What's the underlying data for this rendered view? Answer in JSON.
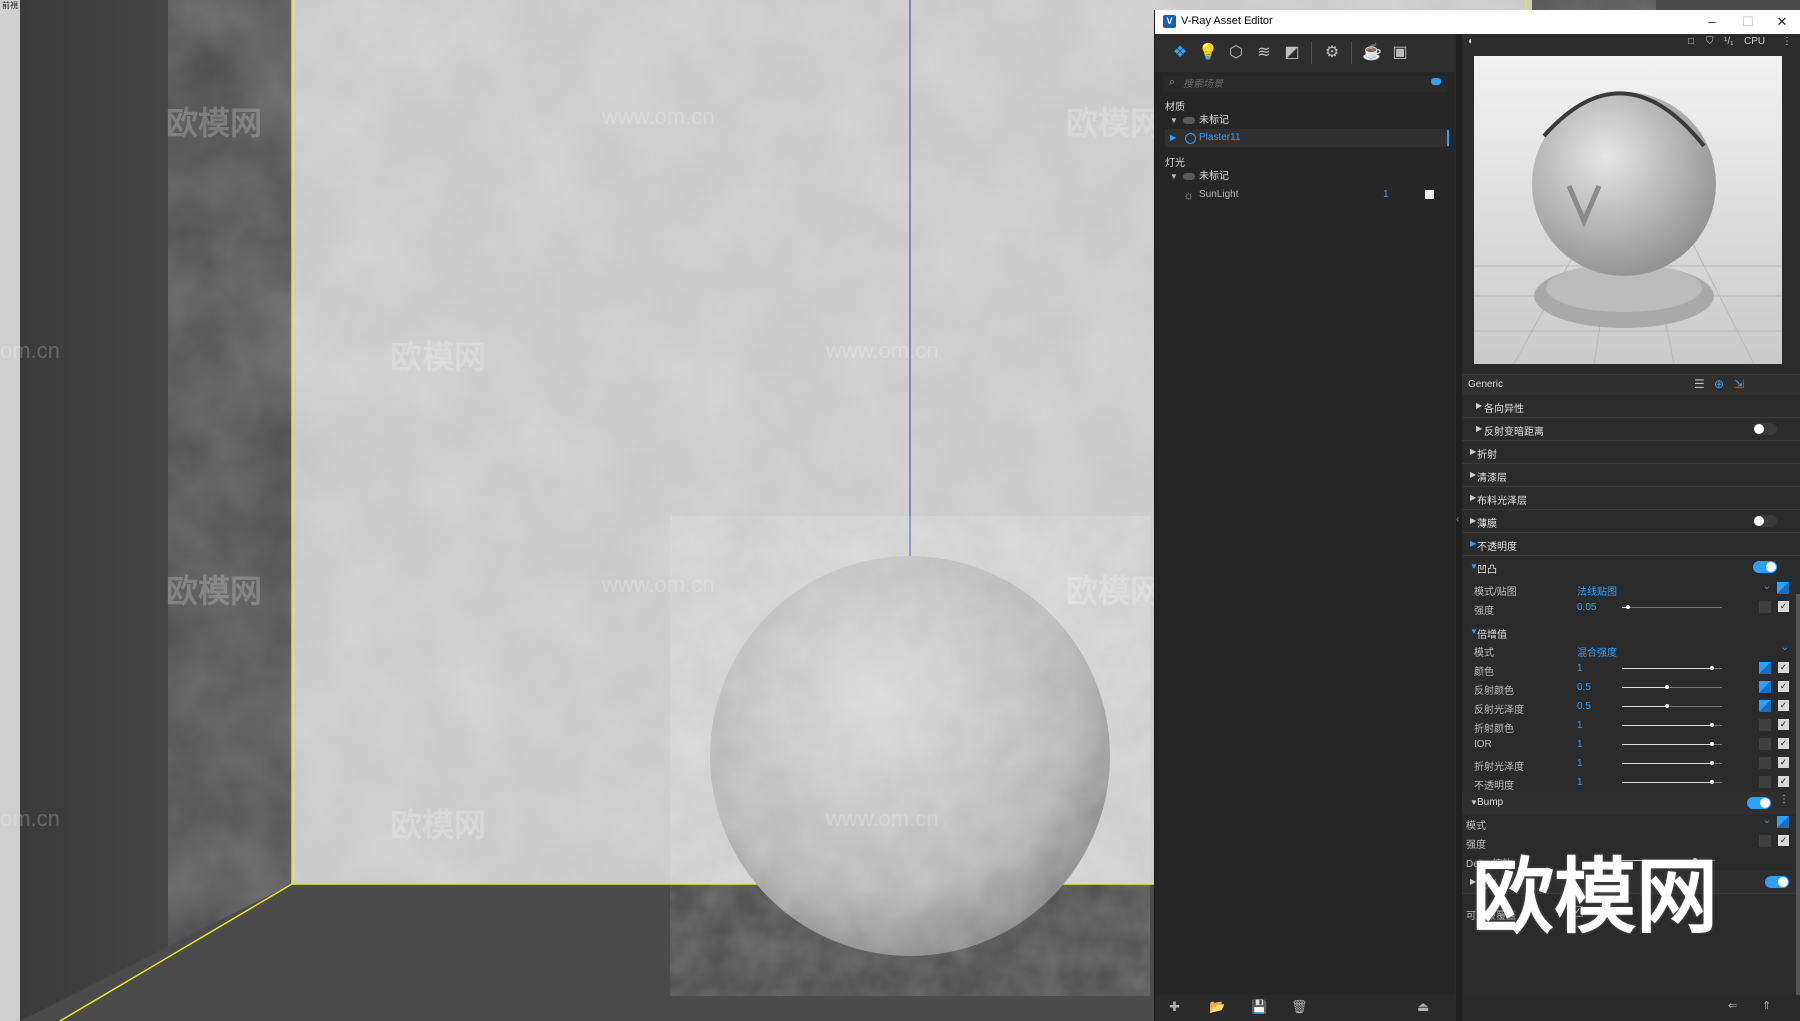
{
  "viewport": {
    "corner_label": "前視",
    "watermark_text": "欧模网",
    "watermark_url": "www.om.cn",
    "watermark_url_short": "om.cn",
    "big_watermark": "欧模网"
  },
  "window": {
    "title": "V-Ray Asset Editor",
    "icon_letter": "V",
    "minimize": "–",
    "maximize": "☐",
    "close": "✕"
  },
  "toolbar": {
    "icons": [
      "materials-icon",
      "lights-icon",
      "geometry-icon",
      "layers-icon",
      "render-elements-icon",
      "settings-icon",
      "teapot-icon",
      "frame-buffer-icon"
    ]
  },
  "search": {
    "placeholder": "搜索场景"
  },
  "materials": {
    "category": "材质",
    "group": "未标记",
    "items": [
      {
        "name": "Plaster11"
      }
    ]
  },
  "lights": {
    "category": "灯光",
    "group": "未标记",
    "items": [
      {
        "name": "SunLight",
        "count": "1"
      }
    ]
  },
  "preview_toolbar": {
    "ratio": "¹/₁",
    "device": "CPU"
  },
  "properties": {
    "title": "Generic",
    "sections": {
      "anisotropy": "各向异性",
      "retrace": "反射变暗距离",
      "refraction": "折射",
      "coat": "清漆层",
      "sheen": "布料光泽层",
      "thin_film": "薄膜",
      "opacity": "不透明度",
      "bump": "凹凸",
      "multipliers": "倍增值",
      "binding": "关联"
    },
    "bump": {
      "mode_label": "模式/贴图",
      "mode_value": "法线贴图",
      "amount_label": "强度",
      "amount_value": "0.05"
    },
    "multipliers": {
      "mode_label": "模式",
      "mode_value": "混合强度",
      "rows": [
        {
          "label": "颜色",
          "value": "1",
          "fill": 0.9
        },
        {
          "label": "反射颜色",
          "value": "0.5",
          "fill": 0.45
        },
        {
          "label": "反射光泽度",
          "value": "0.5",
          "fill": 0.45
        },
        {
          "label": "折射颜色",
          "value": "1",
          "fill": 0.9
        },
        {
          "label": "IOR",
          "value": "1",
          "fill": 0.9
        },
        {
          "label": "折射光泽度",
          "value": "1",
          "fill": 0.9
        },
        {
          "label": "不透明度",
          "value": "1",
          "fill": 0.9
        }
      ]
    },
    "bump2": {
      "title": "Bump",
      "mode_label": "模式",
      "amount_label": "强度",
      "delta_label": "Delta 缩放",
      "delta_value": "1"
    },
    "can_override_label": "可以被覆盖"
  },
  "colors": {
    "accent": "#2ea0ff",
    "panel": "#2b2b2b",
    "viewport_wall": "#c8c8c8",
    "selection_edge": "#e8e820"
  }
}
